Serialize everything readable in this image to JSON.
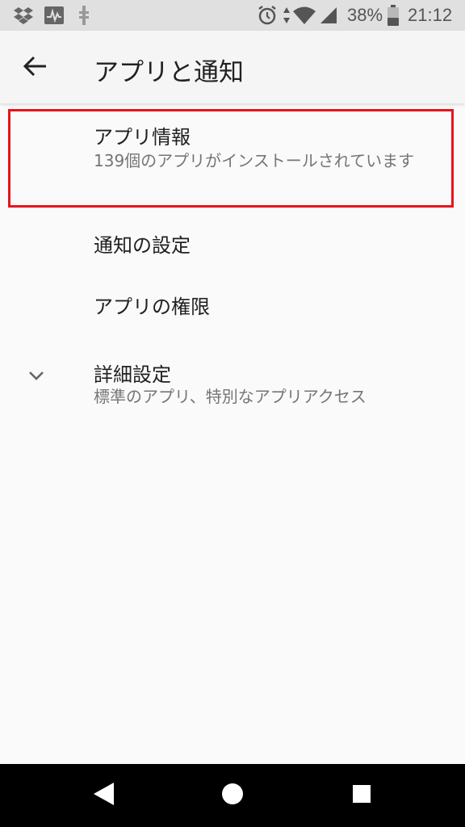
{
  "status_bar": {
    "battery_percent": "38%",
    "time": "21:12",
    "icons": [
      "dropbox-icon",
      "activity-monitor-icon",
      "usb-debug-icon",
      "alarm-icon",
      "data-transfer-icon",
      "wifi-icon",
      "cell-signal-icon",
      "battery-icon"
    ]
  },
  "app_bar": {
    "title": "アプリと通知",
    "back_icon": "arrow-back-icon"
  },
  "items": [
    {
      "title": "アプリ情報",
      "subtitle": "139個のアプリがインストールされています",
      "highlighted": true
    },
    {
      "title": "通知の設定"
    },
    {
      "title": "アプリの権限"
    },
    {
      "title": "詳細設定",
      "subtitle": "標準のアプリ、特別なアプリアクセス",
      "icon": "chevron-down-icon"
    }
  ],
  "nav_bar": {
    "buttons": [
      "back-triangle-icon",
      "home-circle-icon",
      "recents-square-icon"
    ]
  },
  "colors": {
    "highlight": "#e8141b",
    "background": "#fafafa",
    "status_bar": "#e0e0e0",
    "nav_bar": "#000000"
  }
}
